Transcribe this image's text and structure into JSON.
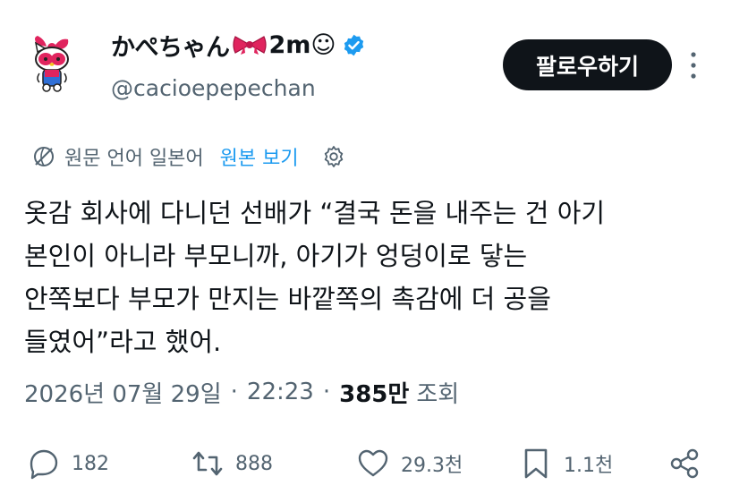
{
  "author": {
    "display_name": "かぺちゃん",
    "name_suffix": "2m☺",
    "handle": "@cacioepepechan",
    "verified": true
  },
  "follow_button": {
    "label": "팔로우하기"
  },
  "translation": {
    "label": "원문 언어 일본어",
    "view_original": "원본 보기"
  },
  "tweet": {
    "lines": [
      "옷감 회사에 다니던 선배가 “결국 돈을 내주는 건 아기",
      "본인이 아니라 부모니까, 아기가 엉덩이로 닿는",
      "안쪽보다 부모가 만지는 바깥쪽의 촉감에 더 공을",
      "들였어”라고 했어."
    ]
  },
  "meta": {
    "date": "2026년 07월 29일",
    "separator": "·",
    "time": "22:23",
    "views_count": "385만",
    "views_label": "조회"
  },
  "actions": {
    "replies": "182",
    "reposts": "888",
    "likes": "29.3천",
    "bookmarks": "1.1천"
  },
  "colors": {
    "text": "#0f1419",
    "secondary": "#536471",
    "accent": "#1d9bf0",
    "follow_bg": "#0f1419",
    "bow": "#e0245e"
  },
  "icons": [
    "avatar-hello-kitty",
    "ribbon-bow-icon",
    "verified-badge-icon",
    "more-options-icon",
    "translate-icon",
    "settings-icon",
    "reply-icon",
    "repost-icon",
    "like-icon",
    "bookmark-icon",
    "share-icon"
  ]
}
